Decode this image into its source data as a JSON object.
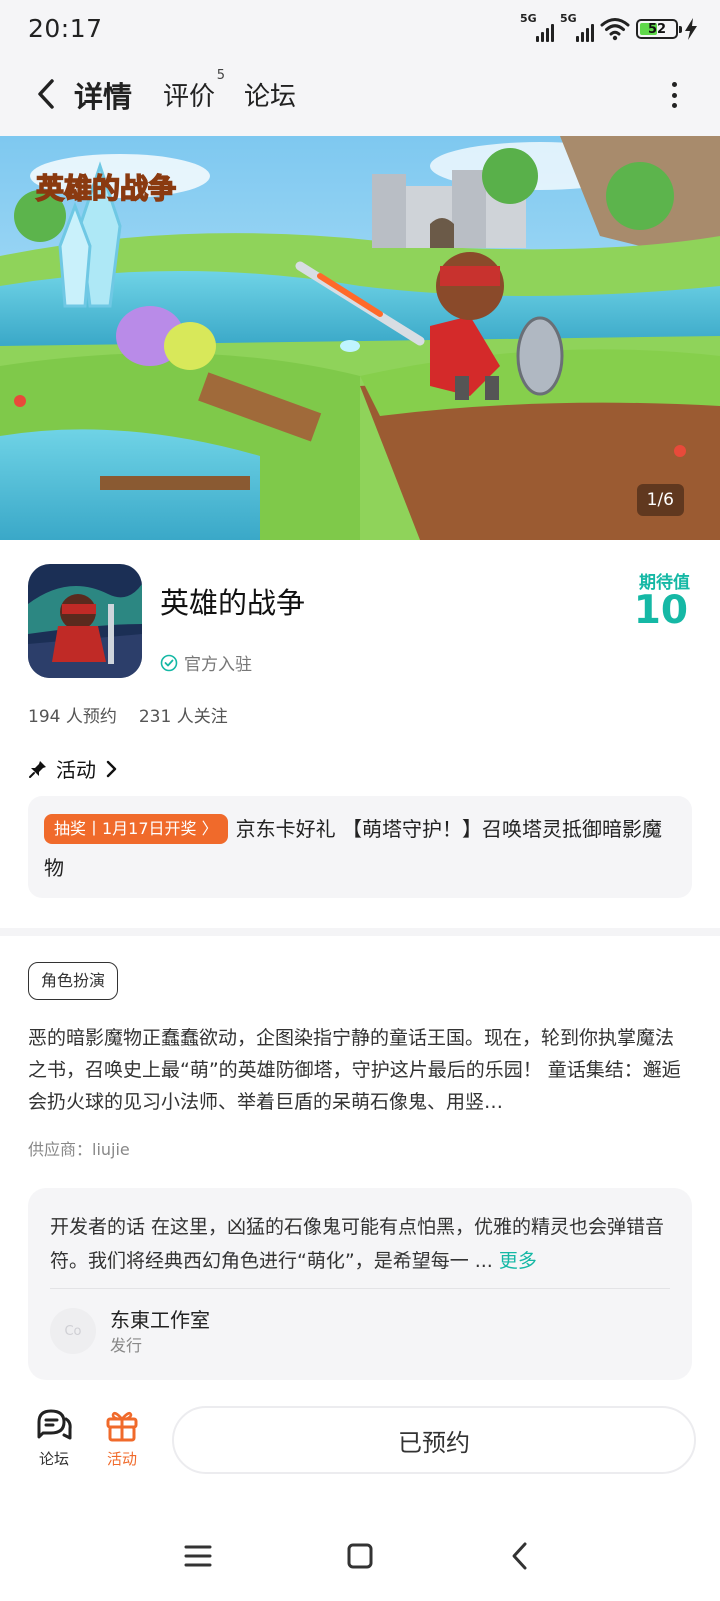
{
  "status_bar": {
    "time": "20:17",
    "network_1": "5G",
    "network_2": "5G",
    "battery": "52",
    "icons": [
      "signal-icon",
      "signal-icon",
      "wifi-icon",
      "battery-icon",
      "charging-icon"
    ]
  },
  "nav": {
    "back_icon": "chevron-left-icon",
    "tabs": [
      {
        "label": "详情",
        "active": true
      },
      {
        "label": "评价",
        "badge": "5"
      },
      {
        "label": "论坛"
      }
    ],
    "more_icon": "more-vertical-icon"
  },
  "banner": {
    "logo_text": "英雄的战争",
    "counter": "1/6"
  },
  "game": {
    "title": "英雄的战争",
    "official": "官方入驻",
    "expect_label": "期待值",
    "expect_value": "10",
    "reservations": "194 人预约",
    "followers": "231 人关注"
  },
  "activity": {
    "heading": "活动",
    "tag": "抽奖丨1月17日开奖 〉",
    "text": "京东卡好礼 【萌塔守护！】召唤塔灵抵御暗影魔物"
  },
  "genre": "角色扮演",
  "description": "恶的暗影魔物正蠢蠢欲动，企图染指宁静的童话王国。现在，轮到你执掌魔法之书，召唤史上最“萌”的英雄防御塔，守护这片最后的乐园！ 童话集结：邂逅会扔火球的见习小法师、举着巨盾的呆萌石像鬼、用竖…",
  "supplier": "供应商：liujie",
  "developer": {
    "text": "开发者的话  在这里，凶猛的石像鬼可能有点怕黑，优雅的精灵也会弹错音符。我们将经典西幻角色进行“萌化”，是希望每一 ...",
    "more": "更多",
    "avatar_text": "Co",
    "studio": "东東工作室",
    "role": "发行"
  },
  "bottom_bar": {
    "forum_label": "论坛",
    "activity_label": "活动",
    "reserve_label": "已预约"
  },
  "colors": {
    "accent": "#15b8a5",
    "promo": "#f06a2b",
    "activity_icon": "#f06a2b"
  }
}
